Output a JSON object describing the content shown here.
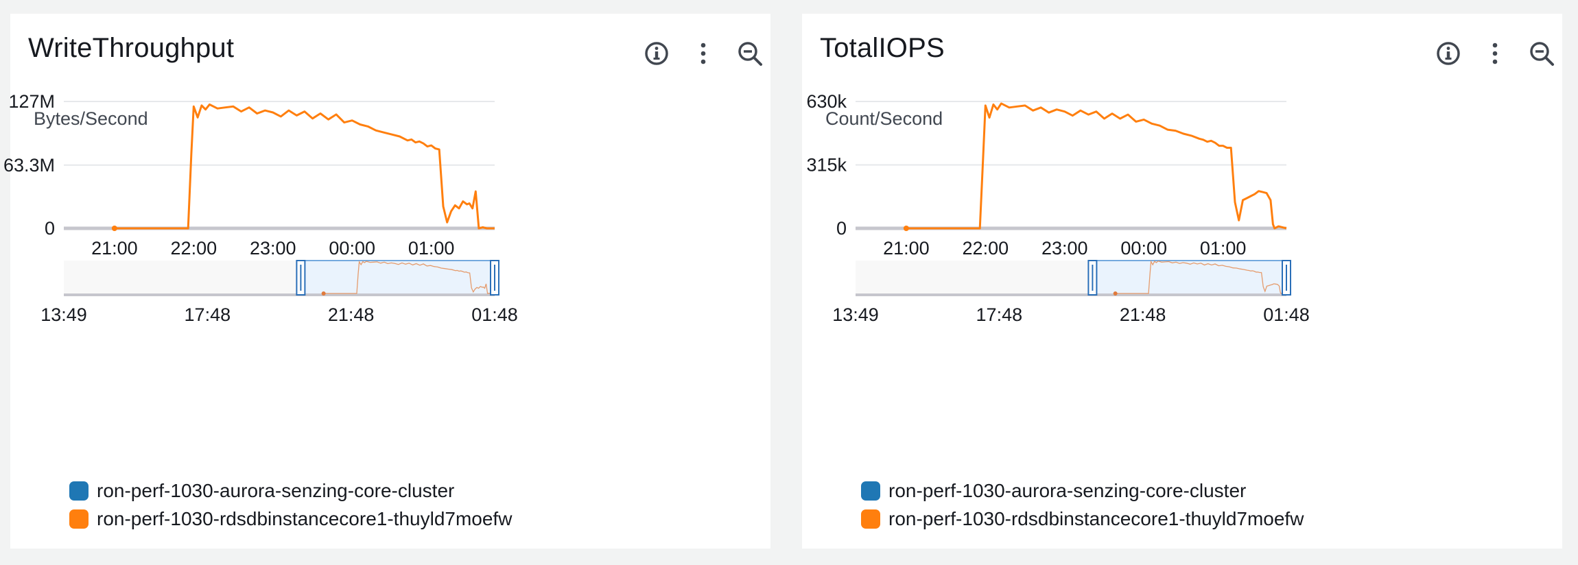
{
  "panels": [
    {
      "title": "WriteThroughput",
      "icons": [
        "info-icon",
        "more-vertical-icon",
        "zoom-out-icon"
      ],
      "unit": "Bytes/Second",
      "legend": [
        {
          "label": "ron-perf-1030-aurora-senzing-core-cluster",
          "color": "#1f77b4"
        },
        {
          "label": "ron-perf-1030-rdsdbinstancecore1-thuyld7moefw",
          "color": "#ff7f0e"
        }
      ]
    },
    {
      "title": "TotalIOPS",
      "icons": [
        "info-icon",
        "more-vertical-icon",
        "zoom-out-icon"
      ],
      "unit": "Count/Second",
      "legend": [
        {
          "label": "ron-perf-1030-aurora-senzing-core-cluster",
          "color": "#1f77b4"
        },
        {
          "label": "ron-perf-1030-rdsdbinstancecore1-thuyld7moefw",
          "color": "#ff7f0e"
        }
      ]
    }
  ],
  "chart_data": [
    {
      "type": "line",
      "title": "WriteThroughput",
      "ylabel": "Bytes/Second",
      "xlabel": "",
      "ylim": [
        0,
        127000000
      ],
      "yticks": [
        {
          "value": 0,
          "label": "0"
        },
        {
          "value": 63300000,
          "label": "63.3M"
        },
        {
          "value": 127000000,
          "label": "127M"
        }
      ],
      "xlim_hours": [
        20.36,
        25.8
      ],
      "xticks": [
        {
          "value": 21,
          "label": "21:00"
        },
        {
          "value": 22,
          "label": "22:00"
        },
        {
          "value": 23,
          "label": "23:00"
        },
        {
          "value": 24,
          "label": "00:00"
        },
        {
          "value": 25,
          "label": "01:00"
        }
      ],
      "grid": true,
      "legend_position": "bottom-left",
      "series": [
        {
          "name": "ron-perf-1030-aurora-senzing-core-cluster",
          "color": "#1f77b4",
          "x": [],
          "y": []
        },
        {
          "name": "ron-perf-1030-rdsdbinstancecore1-thuyld7moefw",
          "color": "#ff7f0e",
          "x": [
            21.0,
            21.5,
            21.93,
            21.97,
            22.0,
            22.05,
            22.1,
            22.15,
            22.2,
            22.3,
            22.4,
            22.5,
            22.6,
            22.7,
            22.8,
            22.9,
            23.0,
            23.1,
            23.2,
            23.3,
            23.4,
            23.5,
            23.6,
            23.7,
            23.8,
            23.9,
            24.0,
            24.1,
            24.2,
            24.3,
            24.4,
            24.5,
            24.6,
            24.7,
            24.75,
            24.8,
            24.85,
            24.9,
            24.95,
            25.0,
            25.05,
            25.1,
            25.15,
            25.2,
            25.25,
            25.3,
            25.35,
            25.4,
            25.45,
            25.48,
            25.52,
            25.56,
            25.6,
            25.65,
            25.7,
            25.8
          ],
          "y": [
            0,
            0,
            0,
            75000000,
            122000000,
            111000000,
            123000000,
            119000000,
            124000000,
            120000000,
            121000000,
            122000000,
            117000000,
            121000000,
            115000000,
            118000000,
            116000000,
            112000000,
            118000000,
            113000000,
            117000000,
            110000000,
            115000000,
            109000000,
            114000000,
            106000000,
            108000000,
            104000000,
            102000000,
            98000000,
            96000000,
            94000000,
            92000000,
            88000000,
            89000000,
            86000000,
            87000000,
            85000000,
            82000000,
            83000000,
            80000000,
            79000000,
            22000000,
            6000000,
            17000000,
            23000000,
            20000000,
            27000000,
            24000000,
            25000000,
            20000000,
            37000000,
            0,
            1000000,
            0,
            0
          ]
        }
      ],
      "overview": {
        "xticks": [
          "13:49",
          "17:48",
          "21:48",
          "01:48"
        ],
        "selected_from": 0.55,
        "selected_to": 1.0
      }
    },
    {
      "type": "line",
      "title": "TotalIOPS",
      "ylabel": "Count/Second",
      "xlabel": "",
      "ylim": [
        0,
        630000
      ],
      "yticks": [
        {
          "value": 0,
          "label": "0"
        },
        {
          "value": 315000,
          "label": "315k"
        },
        {
          "value": 630000,
          "label": "630k"
        }
      ],
      "xlim_hours": [
        20.36,
        25.8
      ],
      "xticks": [
        {
          "value": 21,
          "label": "21:00"
        },
        {
          "value": 22,
          "label": "22:00"
        },
        {
          "value": 23,
          "label": "23:00"
        },
        {
          "value": 24,
          "label": "00:00"
        },
        {
          "value": 25,
          "label": "01:00"
        }
      ],
      "grid": true,
      "legend_position": "bottom-left",
      "series": [
        {
          "name": "ron-perf-1030-aurora-senzing-core-cluster",
          "color": "#1f77b4",
          "x": [],
          "y": []
        },
        {
          "name": "ron-perf-1030-rdsdbinstancecore1-thuyld7moefw",
          "color": "#ff7f0e",
          "x": [
            21.0,
            21.5,
            21.93,
            21.97,
            22.0,
            22.05,
            22.1,
            22.15,
            22.2,
            22.3,
            22.4,
            22.5,
            22.6,
            22.7,
            22.8,
            22.9,
            23.0,
            23.1,
            23.2,
            23.3,
            23.4,
            23.5,
            23.6,
            23.7,
            23.8,
            23.9,
            24.0,
            24.1,
            24.2,
            24.3,
            24.4,
            24.5,
            24.6,
            24.7,
            24.75,
            24.8,
            24.85,
            24.9,
            24.95,
            25.0,
            25.05,
            25.1,
            25.15,
            25.2,
            25.25,
            25.3,
            25.35,
            25.4,
            25.45,
            25.5,
            25.55,
            25.6,
            25.63,
            25.65,
            25.7,
            25.8
          ],
          "y": [
            0,
            0,
            0,
            350000,
            610000,
            550000,
            615000,
            590000,
            620000,
            600000,
            605000,
            610000,
            585000,
            600000,
            575000,
            590000,
            580000,
            560000,
            585000,
            565000,
            580000,
            545000,
            570000,
            545000,
            565000,
            530000,
            540000,
            520000,
            510000,
            490000,
            485000,
            470000,
            460000,
            445000,
            440000,
            430000,
            435000,
            425000,
            410000,
            410000,
            400000,
            400000,
            130000,
            40000,
            140000,
            150000,
            160000,
            170000,
            185000,
            180000,
            175000,
            140000,
            20000,
            0,
            10000,
            0
          ]
        }
      ],
      "overview": {
        "xticks": [
          "13:49",
          "17:48",
          "21:48",
          "01:48"
        ],
        "selected_from": 0.55,
        "selected_to": 1.0
      }
    }
  ]
}
